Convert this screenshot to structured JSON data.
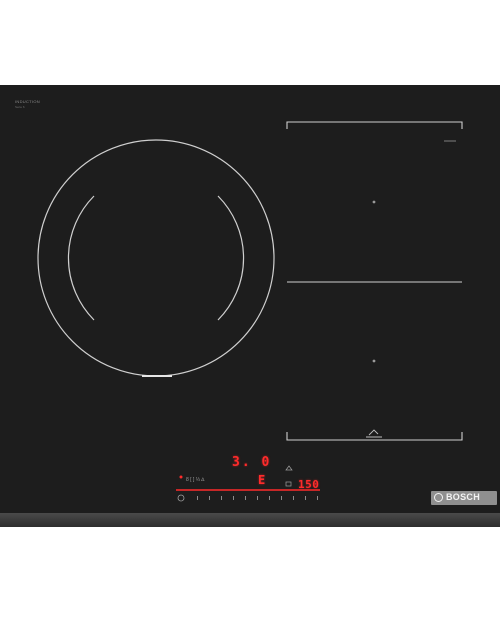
{
  "product": {
    "brand_title": "INDUCTION",
    "brand_sub": "Serie 6"
  },
  "controls": {
    "power_readout": "3. 0",
    "timer_readout": "150",
    "zone_readout": "E",
    "function_label": "8 [ ] ⅓ ∆"
  },
  "logo": {
    "text": "BOSCH",
    "icon": "bosch-logo-icon"
  },
  "colors": {
    "glass": "#1d1d1d",
    "markings": "#cfcfcf",
    "display_red": "#ff2b2b",
    "logo_plate": "#8f8f8f"
  }
}
